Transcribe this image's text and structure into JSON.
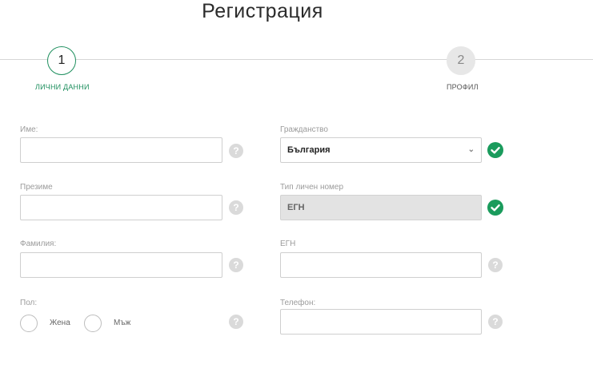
{
  "page": {
    "title": "Регистрация"
  },
  "stepper": {
    "steps": [
      {
        "number": "1",
        "label": "ЛИЧНИ ДАННИ",
        "state": "active"
      },
      {
        "number": "2",
        "label": "ПРОФИЛ",
        "state": "inactive"
      }
    ],
    "active_color": "#1e8f5e"
  },
  "form": {
    "left": {
      "first_name": {
        "label": "Име:",
        "value": ""
      },
      "middle_name": {
        "label": "Презиме",
        "value": ""
      },
      "last_name": {
        "label": "Фамилия:",
        "value": ""
      },
      "gender": {
        "label": "Пол:",
        "options": [
          "Жена",
          "Мъж"
        ],
        "selected": ""
      }
    },
    "right": {
      "citizenship": {
        "label": "Гражданство",
        "value": "България",
        "valid": true
      },
      "id_type": {
        "label": "Тип личен номер",
        "value": "ЕГН",
        "disabled": true,
        "valid": true
      },
      "egn": {
        "label": "ЕГН",
        "value": ""
      },
      "phone": {
        "label": "Телефон:",
        "value": ""
      }
    },
    "help_symbol": "?"
  },
  "colors": {
    "valid": "#1a9b5c",
    "help": "#dadada"
  }
}
